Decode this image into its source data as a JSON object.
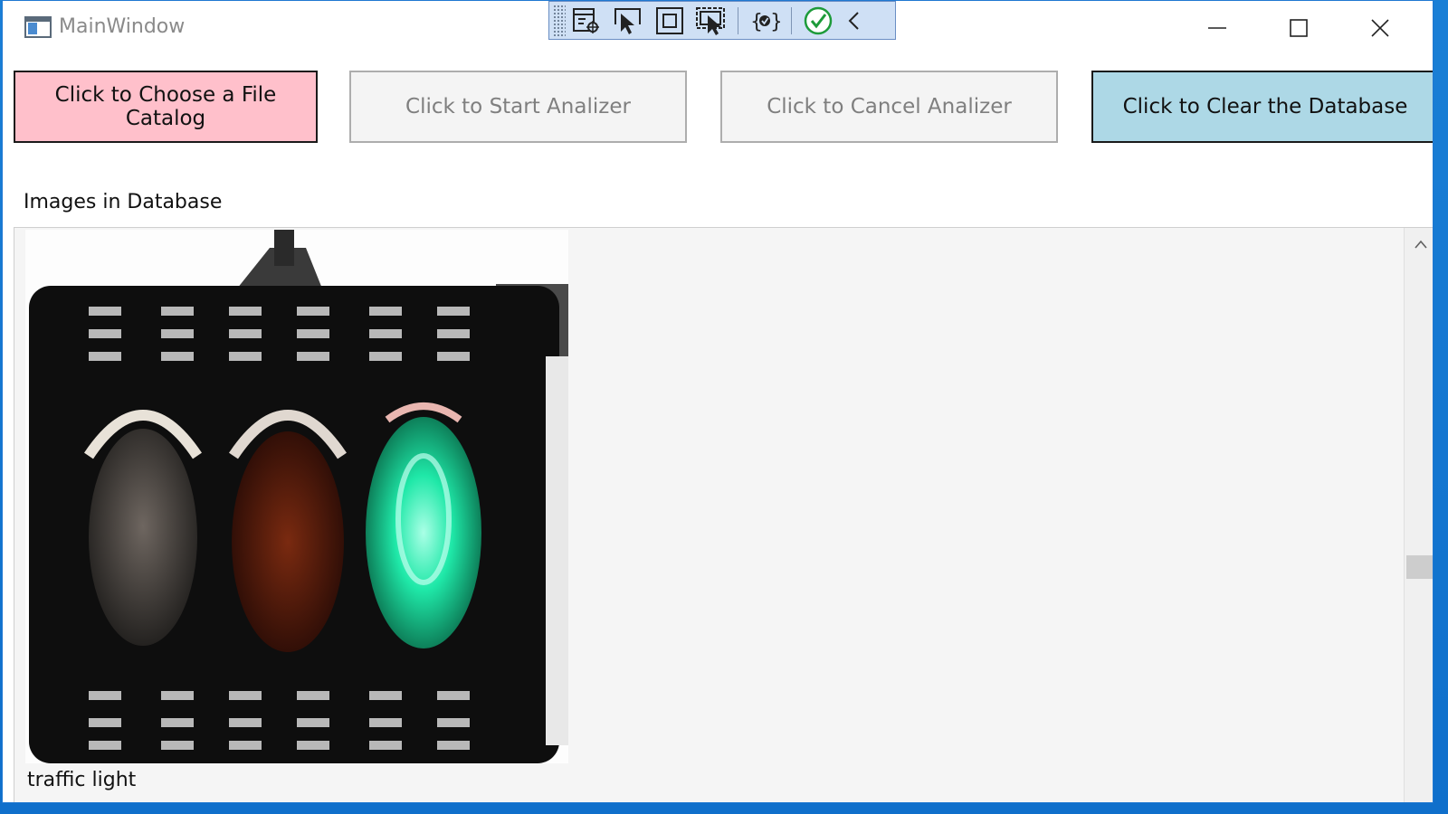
{
  "window": {
    "title": "MainWindow"
  },
  "toolbar": {
    "items": [
      "live-visual-tree-icon",
      "select-element-icon",
      "display-layout-adorners-icon",
      "track-focused-element-icon",
      "binding-failures-icon",
      "hot-reload-check-icon",
      "collapse-chevron-icon"
    ]
  },
  "buttons": {
    "choose": "Click to Choose a File Catalog",
    "start": "Click to Start Analizer",
    "cancel": "Click to Cancel Analizer",
    "clear": "Click to Clear the Database"
  },
  "section": {
    "label": "Images in Database"
  },
  "images": [
    {
      "caption": "traffic light",
      "icon": "traffic-light-image"
    }
  ],
  "colors": {
    "choose_bg": "#ffc0cb",
    "clear_bg": "#add8e6",
    "disabled_bg": "#f4f4f4",
    "disabled_text": "#7f7f7f",
    "desktop": "#1a7fd6",
    "green_light": "#1fe8a8"
  }
}
